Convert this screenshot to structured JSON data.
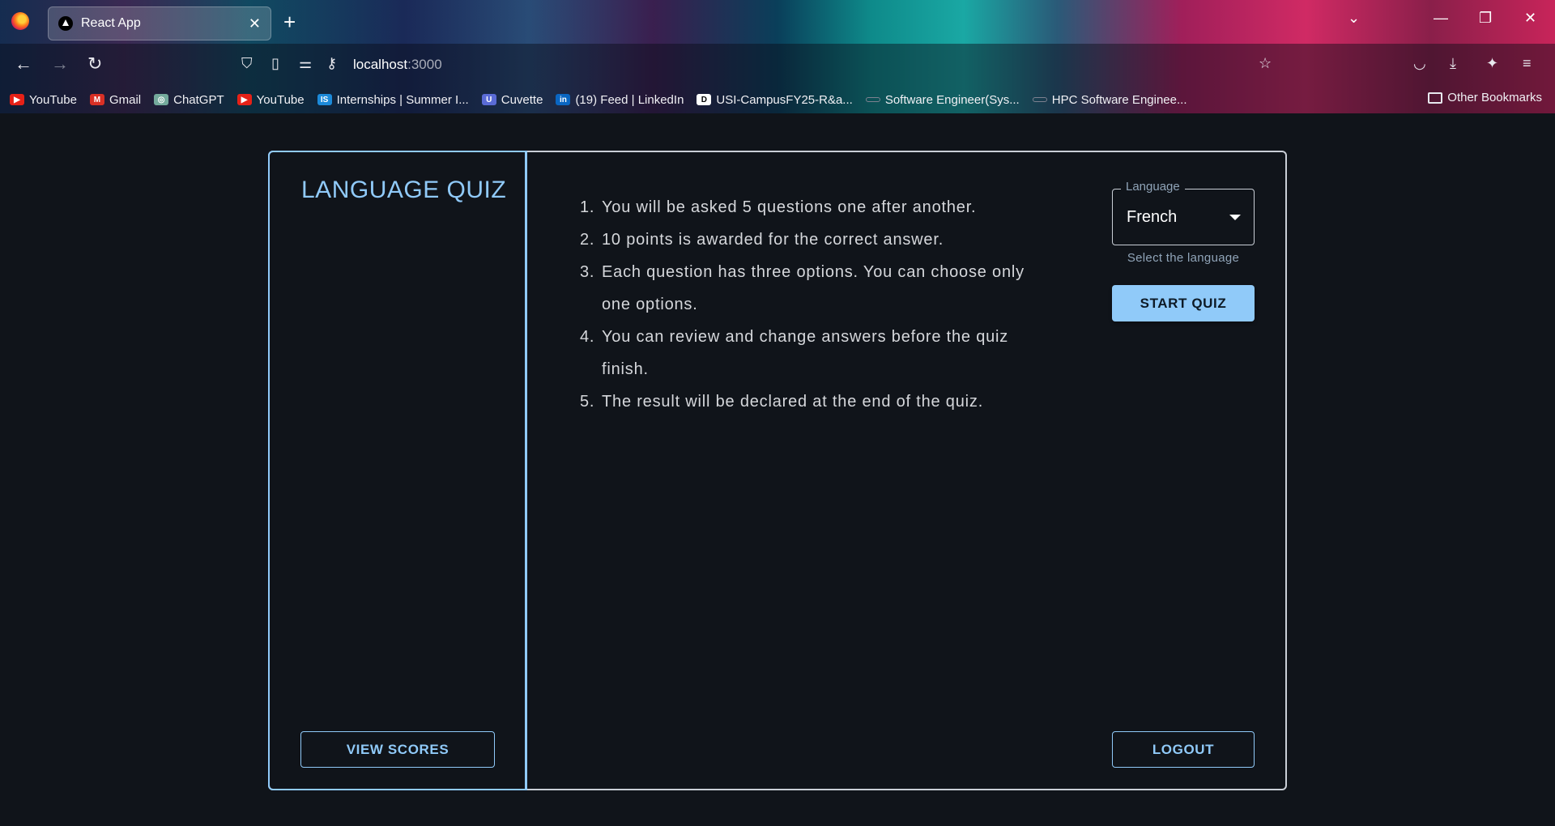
{
  "browser": {
    "tab_title": "React App",
    "tab_close": "✕",
    "new_tab": "+",
    "url_host": "localhost",
    "url_port": ":3000",
    "bookmarks": [
      {
        "label": "YouTube",
        "color": "#e62117",
        "glyph": "▶"
      },
      {
        "label": "Gmail",
        "color": "#d93025",
        "glyph": "M"
      },
      {
        "label": "ChatGPT",
        "color": "#74aa9c",
        "glyph": "◎"
      },
      {
        "label": "YouTube",
        "color": "#e62117",
        "glyph": "▶"
      },
      {
        "label": "Internships | Summer I...",
        "color": "#1c8ad9",
        "glyph": "IS"
      },
      {
        "label": "Cuvette",
        "color": "#5a6bd6",
        "glyph": "U"
      },
      {
        "label": "(19) Feed | LinkedIn",
        "color": "#0a66c2",
        "glyph": "in"
      },
      {
        "label": "USI-CampusFY25-R&a...",
        "color": "#ffffff",
        "glyph": "D"
      },
      {
        "label": "Software Engineer(Sys...",
        "color": "#7d8190",
        "glyph": ""
      },
      {
        "label": "HPC Software Enginee...",
        "color": "#7d8190",
        "glyph": ""
      }
    ],
    "other_bookmarks": "Other Bookmarks"
  },
  "app": {
    "title": "LANGUAGE QUIZ",
    "view_scores": "VIEW SCORES",
    "logout": "LOGOUT",
    "rules": [
      {
        "num": "1.",
        "text": "You will be asked 5 questions one after another."
      },
      {
        "num": "2.",
        "text": "10 points is awarded for the correct answer."
      },
      {
        "num": "3.",
        "text": "Each question has three options. You can choose only one options."
      },
      {
        "num": "4.",
        "text": "You can review and change answers before the quiz finish."
      },
      {
        "num": "5.",
        "text": "The result will be declared at the end of the quiz."
      }
    ],
    "language_select": {
      "label": "Language",
      "value": "French",
      "helper": "Select the language"
    },
    "start_quiz": "START QUIZ"
  },
  "colors": {
    "accent": "#90caf9",
    "background": "#10141a",
    "text": "#d5d7db"
  }
}
